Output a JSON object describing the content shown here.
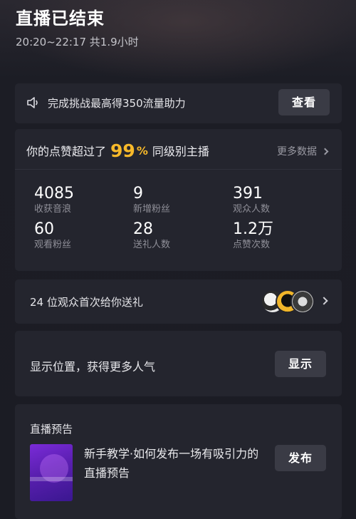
{
  "header": {
    "title": "直播已结束",
    "time_range": "20:20~22:17 共1.9小时"
  },
  "challenge": {
    "text": "完成挑战最高得350流量助力",
    "button": "查看"
  },
  "likes": {
    "prefix": "你的点赞超过了",
    "percent": "99",
    "percent_sign": "%",
    "suffix": "同级别主播",
    "more": "更多数据"
  },
  "stats": [
    {
      "value": "4085",
      "label": "收获音浪"
    },
    {
      "value": "9",
      "label": "新增粉丝"
    },
    {
      "value": "391",
      "label": "观众人数"
    },
    {
      "value": "60",
      "label": "观看粉丝"
    },
    {
      "value": "28",
      "label": "送礼人数"
    },
    {
      "value": "1.2万",
      "label": "点赞次数"
    }
  ],
  "gifts": {
    "text": "24 位观众首次给你送礼"
  },
  "location": {
    "text": "显示位置，获得更多人气",
    "button": "显示"
  },
  "preview": {
    "section": "直播预告",
    "description": "新手教学·如何发布一场有吸引力的直播预告",
    "button": "发布"
  }
}
